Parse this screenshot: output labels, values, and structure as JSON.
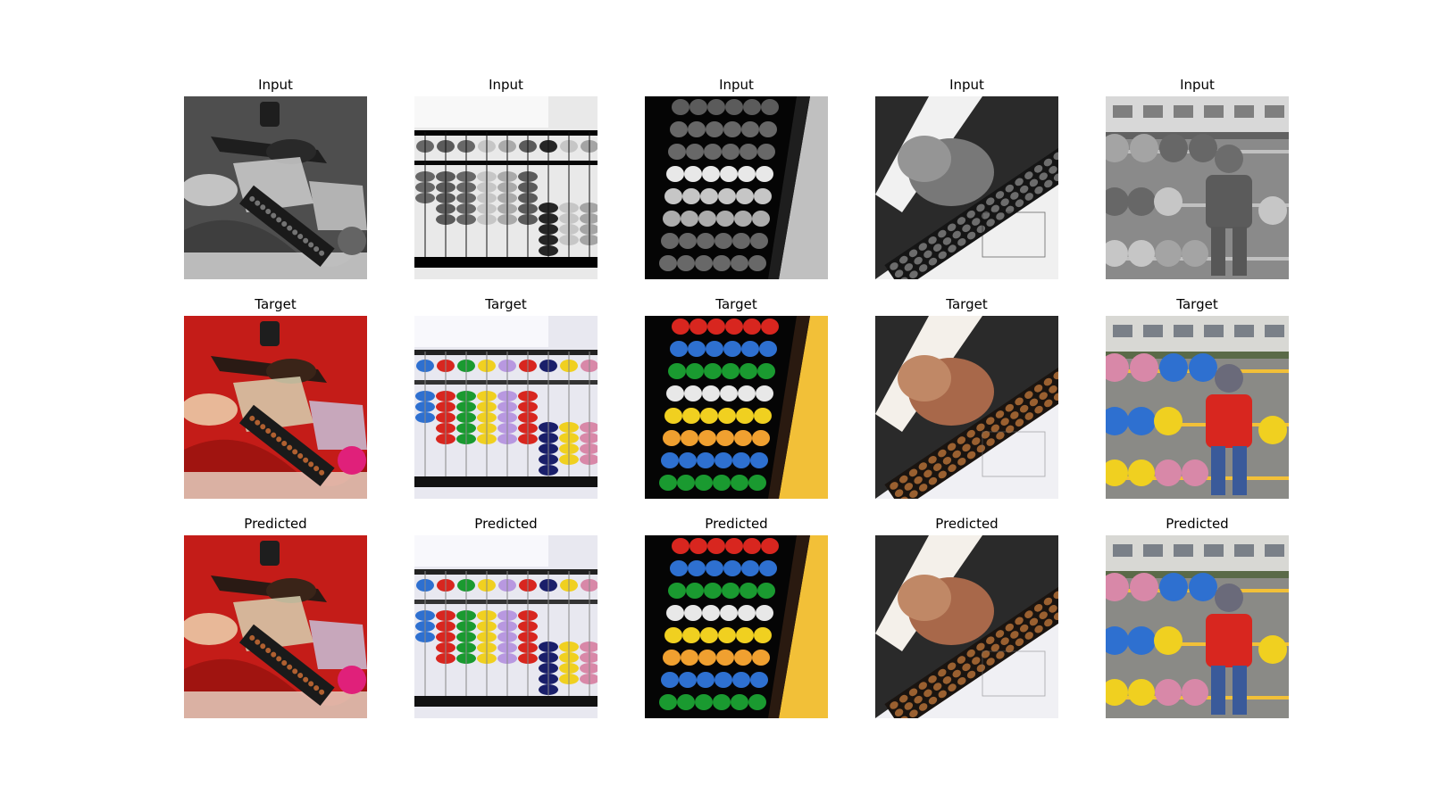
{
  "figure": {
    "row_titles": [
      "Input",
      "Target",
      "Predicted"
    ],
    "columns": [
      {
        "scene": "child-with-violin-and-soroban-on-red-cloth"
      },
      {
        "scene": "abacus-close-up-colored-beads"
      },
      {
        "scene": "abacus-angled-rows-of-beads"
      },
      {
        "scene": "hand-on-soroban-with-paper"
      },
      {
        "scene": "child-behind-giant-abacus-outdoors"
      }
    ]
  },
  "colors": {
    "red": "#d8261f",
    "blue": "#2e70d0",
    "yellow": "#f0d020",
    "green": "#1a9a30",
    "pink": "#d888a8",
    "purple": "#b898e0",
    "navy": "#1a1f6a",
    "brown": "#9a6030",
    "wood": "#f2c038"
  }
}
